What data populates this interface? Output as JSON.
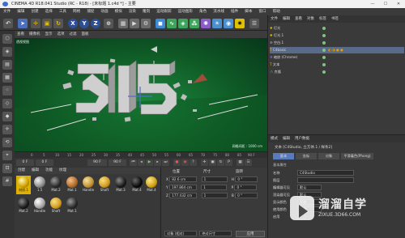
{
  "titlebar": {
    "title": "CINEMA 4D R18.041 Studio (RC - R18) - [未标题 1.c4d *] - 主要",
    "min": "—",
    "max": "☐",
    "close": "✕"
  },
  "menubar": [
    "文件",
    "编辑",
    "创建",
    "选择",
    "工具",
    "网格",
    "捕捉",
    "动画",
    "模拟",
    "渲染",
    "雕刻",
    "运动跟踪",
    "运动图形",
    "角色",
    "流水线",
    "插件",
    "脚本",
    "窗口",
    "帮助"
  ],
  "toolbar": {
    "undo": "↶",
    "move": "✛",
    "scale": "▣",
    "rotate": "↻",
    "x": "X",
    "y": "Y",
    "z": "Z",
    "coord": "⊕"
  },
  "viewport": {
    "menu": [
      "查看",
      "摄像机",
      "显示",
      "选项",
      "过滤",
      "面板"
    ],
    "label": "透视视图",
    "grid": "网格间距 : 1000 cm"
  },
  "timeline": {
    "marks": [
      "0",
      "5",
      "10",
      "15",
      "20",
      "25",
      "30",
      "35",
      "40",
      "45",
      "50",
      "55",
      "60",
      "65",
      "70",
      "75",
      "80",
      "85",
      "90 F"
    ],
    "start": "0 F",
    "current": "0 F",
    "end": "90 F",
    "end2": "90 F"
  },
  "materials": {
    "menu": [
      "创建",
      "编辑",
      "功能",
      "纹理"
    ],
    "items": [
      {
        "name": "材质.1",
        "color": "#f0c000"
      },
      {
        "name": "1.5",
        "color": "#9a9a9a"
      },
      {
        "name": "Mat.2",
        "color": "#3a3a3a"
      },
      {
        "name": "Mat.1",
        "color": "#c07a3a"
      },
      {
        "name": "Handle",
        "color": "#c8a040"
      },
      {
        "name": "Shaft",
        "color": "#d4a030"
      },
      {
        "name": "Mat.3",
        "color": "#202020"
      },
      {
        "name": "Mat.4",
        "color": "#101010"
      },
      {
        "name": "Mat.4",
        "color": "#d8a020"
      },
      {
        "name": "Mat.2",
        "color": "#2a2a2a"
      },
      {
        "name": "Handle",
        "color": "#b0b0b0"
      },
      {
        "name": "Shaft",
        "color": "#d4a030"
      },
      {
        "name": "Mat.1",
        "color": "#303030"
      }
    ]
  },
  "coords": {
    "headers": [
      "位置",
      "尺寸",
      "旋转"
    ],
    "rows": [
      {
        "axis": "X",
        "pos": "82.6 cm",
        "size": "1",
        "rot": "H",
        "rotv": "0 °"
      },
      {
        "axis": "Y",
        "pos": "197.864 cm",
        "size": "1",
        "rot": "P",
        "rotv": "0 °"
      },
      {
        "axis": "Z",
        "pos": "177.432 cm",
        "size": "1",
        "rot": "B",
        "rotv": "0 °"
      }
    ],
    "mode1": "对象 (相对)",
    "mode2": "绝对尺寸",
    "apply": "应用"
  },
  "objects": {
    "menu": [
      "文件",
      "编辑",
      "查看",
      "对象",
      "标签",
      "书签"
    ],
    "rows": [
      {
        "name": "灯光",
        "sel": false
      },
      {
        "name": "灯光.1",
        "sel": false
      },
      {
        "name": "空白.1",
        "sel": false
      },
      {
        "name": "C4basic",
        "sel": true
      },
      {
        "name": "缩放 (Chrome)",
        "sel": false
      },
      {
        "name": "文本",
        "sel": false
      },
      {
        "name": "克隆",
        "sel": false
      }
    ]
  },
  "attributes": {
    "menu": [
      "模式",
      "编辑",
      "用户数据"
    ],
    "title": "文本 [C4Studio, 立方体.1 / 样条2]",
    "tabs": [
      "基本",
      "坐标",
      "对象",
      "平滑着色(Phong)"
    ],
    "section": "基本属性",
    "rows": [
      {
        "label": "名称",
        "value": "C4Studio"
      },
      {
        "label": "图层",
        "value": ""
      },
      {
        "label": "编辑器可见",
        "value": "默认"
      },
      {
        "label": "渲染器可见",
        "value": "默认"
      },
      {
        "label": "显示颜色",
        "value": "开启"
      },
      {
        "label": "使用颜色",
        "value": "关闭"
      },
      {
        "label": "启用",
        "value": "✓"
      }
    ]
  },
  "watermark": {
    "text": "溜溜自学",
    "url": "ZIXUE.3D66.COM"
  }
}
